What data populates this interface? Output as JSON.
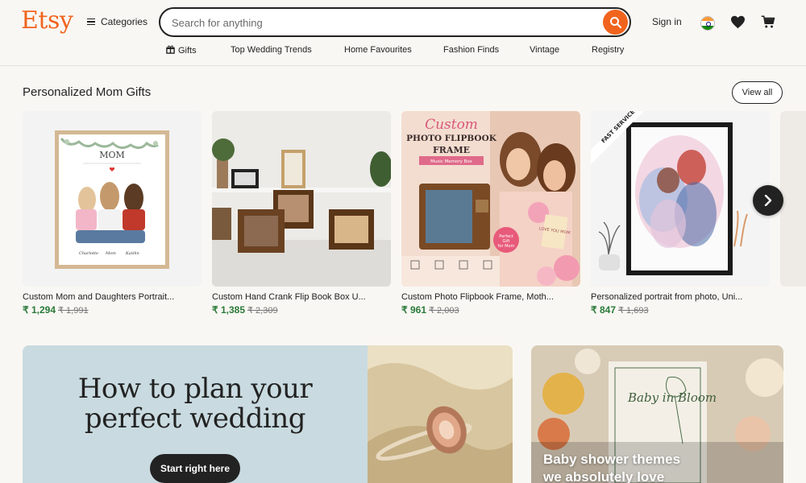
{
  "header": {
    "logo": "Etsy",
    "categories_label": "Categories",
    "search_placeholder": "Search for anything",
    "signin_label": "Sign in",
    "accent_color": "#f1641e"
  },
  "nav": {
    "items": [
      {
        "label": "Gifts",
        "icon": "gift-icon"
      },
      {
        "label": "Top Wedding Trends"
      },
      {
        "label": "Home Favourites"
      },
      {
        "label": "Fashion Finds"
      },
      {
        "label": "Vintage"
      },
      {
        "label": "Registry"
      }
    ]
  },
  "section": {
    "title": "Personalized Mom Gifts",
    "view_all_label": "View all",
    "products": [
      {
        "title": "Custom Mom and Daughters Portrait...",
        "price": "₹ 1,294",
        "original_price": "₹ 1,991",
        "image_text": {
          "heading": "MOM",
          "names": [
            "Charlotte",
            "Mom",
            "Kaitlin"
          ]
        }
      },
      {
        "title": "Custom Hand Crank Flip Book Box U...",
        "price": "₹ 1,385",
        "original_price": "₹ 2,309"
      },
      {
        "title": "Custom Photo Flipbook Frame, Moth...",
        "price": "₹ 961",
        "original_price": "₹ 2,003",
        "image_text": {
          "script": "Custom",
          "line1": "PHOTO FLIPBOOK",
          "line2": "FRAME",
          "ribbon": "Music Memory Box",
          "badge1": "Perfect",
          "badge2": "Gift",
          "badge3": "for Mom",
          "tag": "LOVE YOU MOM"
        }
      },
      {
        "title": "Personalized portrait from photo, Uni...",
        "price": "₹ 847",
        "original_price": "₹ 1,693",
        "image_text": {
          "ribbon": "FAST SERVICE"
        }
      }
    ]
  },
  "banners": {
    "wedding": {
      "heading_line1": "How to plan your",
      "heading_line2": "perfect wedding",
      "cta": "Start right here"
    },
    "baby_shower": {
      "text_line1": "Baby shower themes",
      "text_line2": "we absolutely love",
      "card_text": "Baby in Bloom"
    }
  },
  "colors": {
    "price_green": "#2a7a3a",
    "dark": "#222222",
    "bg": "#f9f7f3"
  }
}
